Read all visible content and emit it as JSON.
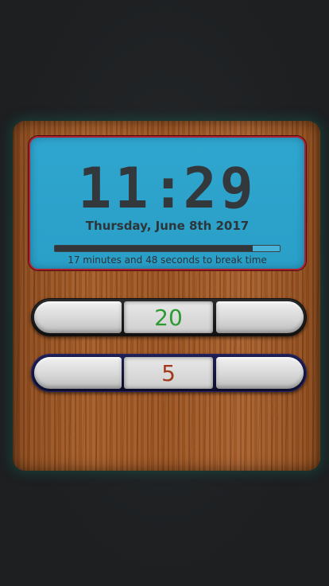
{
  "timer": {
    "hours": "11",
    "separator": ":",
    "minutes": "29",
    "date": "Thursday, June 8th 2017",
    "progress_fraction": 0.88,
    "break_text": "17 minutes and 48 seconds to break time"
  },
  "work_stepper": {
    "value": "20"
  },
  "break_stepper": {
    "value": "5"
  },
  "colors": {
    "lcd_background": "#2fa6cf",
    "lcd_border": "#b0202c",
    "work_value": "#2c9a31",
    "break_value": "#a2391a",
    "break_stepper_border": "#23246a"
  }
}
